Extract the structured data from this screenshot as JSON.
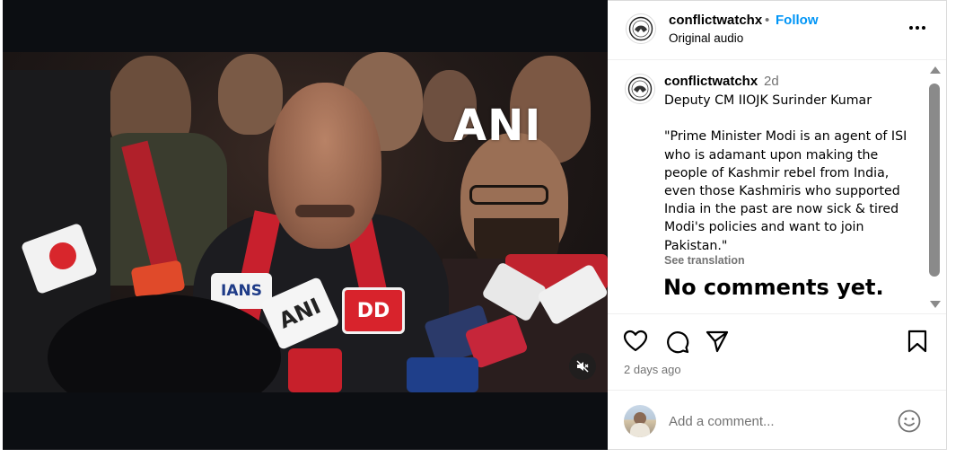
{
  "post": {
    "username": "conflictwatchx",
    "separator": "•",
    "follow_label": "Follow",
    "audio_label": "Original audio",
    "caption_time": "2d",
    "caption_text": "Deputy CM IIOJK Surinder Kumar\n\n\"Prime Minister Modi is an agent of ISI who is adamant upon making the people of Kashmir rebel from India, even those Kashmiris who supported India in the past are now sick & tired Modi's policies and want to join Pakistan.\"",
    "see_translation_label": "See translation",
    "no_comments_text": "No comments yet.",
    "posted_time": "2 days ago"
  },
  "media": {
    "watermark": "ANI",
    "mic_labels": [
      "IANS",
      "ANI",
      "DD"
    ],
    "mute_icon": "speaker-muted-icon"
  },
  "actions": {
    "icons": [
      "heart-icon",
      "comment-icon",
      "share-icon",
      "bookmark-icon"
    ]
  },
  "comment_box": {
    "placeholder": "Add a comment...",
    "emoji_icon": "smiley-icon"
  },
  "colors": {
    "link_blue": "#0095f6",
    "secondary_text": "#737373",
    "border": "#dbdbdb",
    "media_bg": "#0c0e12"
  }
}
